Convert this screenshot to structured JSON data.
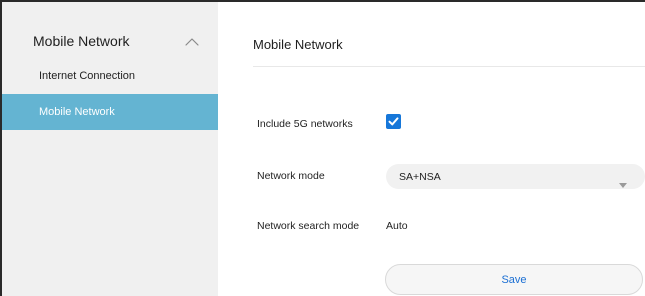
{
  "colors": {
    "sidebar_background": "#f0f0f0",
    "sidebar_active_background": "#64b4d2",
    "checkbox_accent": "#1677d9",
    "save_text": "#1b6fd3"
  },
  "sidebar": {
    "title": "Mobile Network",
    "toggle_icon": "chevron-up-icon",
    "items": [
      {
        "label": "Internet Connection"
      },
      {
        "label": "Mobile Network"
      }
    ]
  },
  "main": {
    "title": "Mobile Network",
    "include_5g": {
      "label": "Include 5G networks",
      "checked": true,
      "icon": "checkmark-icon"
    },
    "network_mode": {
      "label": "Network mode",
      "value": "SA+NSA",
      "icon": "caret-down-icon"
    },
    "network_search_mode": {
      "label": "Network search mode",
      "value": "Auto"
    },
    "save_label": "Save"
  }
}
